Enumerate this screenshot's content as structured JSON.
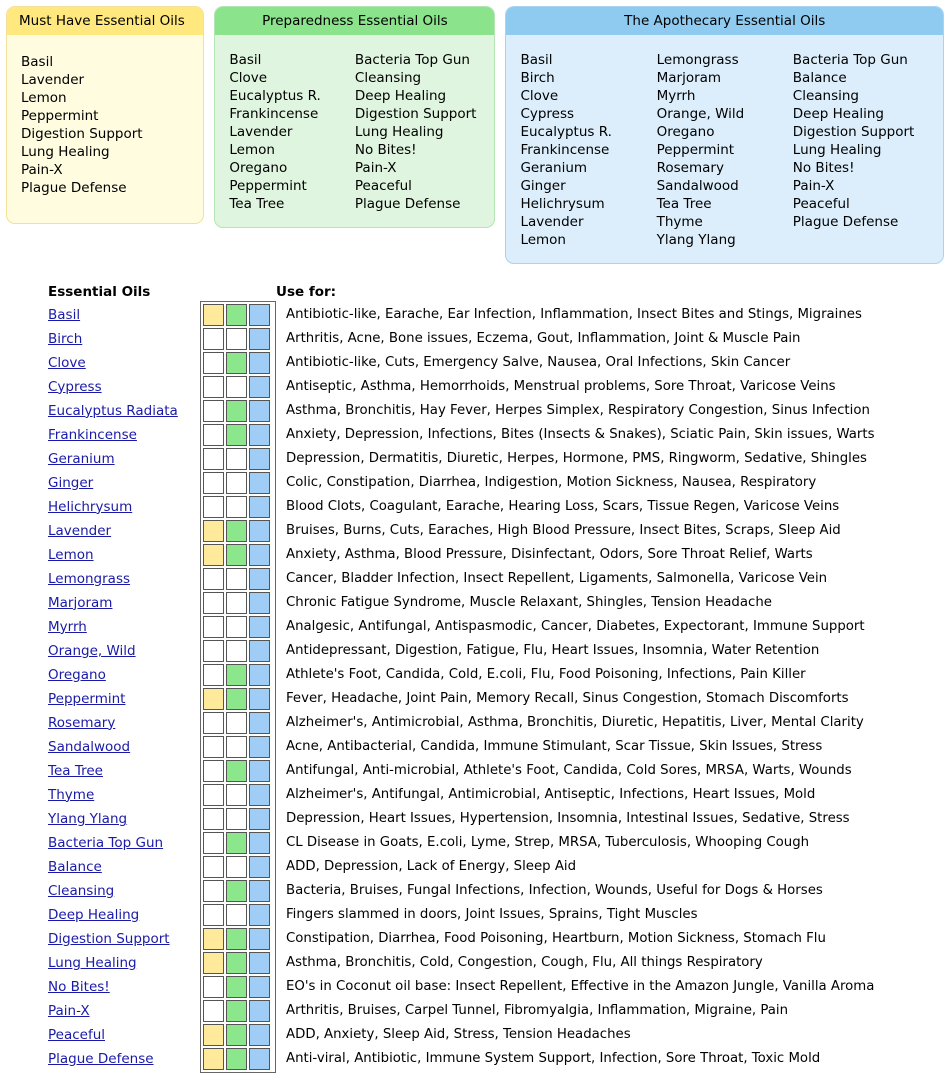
{
  "cards": [
    {
      "id": "must-have",
      "title": "Must Have Essential Oils",
      "header_color": "#ffe97f",
      "body_color": "#fffce0",
      "columns": [
        [
          "Basil",
          "Lavender",
          "Lemon",
          "Peppermint",
          "Digestion Support",
          "Lung Healing",
          "Pain-X",
          "Plague Defense"
        ]
      ]
    },
    {
      "id": "preparedness",
      "title": "Preparedness Essential Oils",
      "header_color": "#8be38b",
      "body_color": "#dff5df",
      "columns": [
        [
          "Basil",
          "Clove",
          "Eucalyptus R.",
          "Frankincense",
          "Lavender",
          "Lemon",
          "Oregano",
          "Peppermint",
          "Tea Tree"
        ],
        [
          "Bacteria Top Gun",
          "Cleansing",
          "Deep Healing",
          "Digestion Support",
          "Lung Healing",
          "No Bites!",
          "Pain-X",
          "Peaceful",
          "Plague Defense"
        ]
      ]
    },
    {
      "id": "apothecary",
      "title": "The Apothecary Essential Oils",
      "header_color": "#8fcbf0",
      "body_color": "#dceefb",
      "columns": [
        [
          "Basil",
          "Birch",
          "Clove",
          "Cypress",
          "Eucalyptus R.",
          "Frankincense",
          "Geranium",
          "Ginger",
          "Helichrysum",
          "Lavender",
          "Lemon"
        ],
        [
          "Lemongrass",
          "Marjoram",
          "Myrrh",
          "Orange, Wild",
          "Oregano",
          "Peppermint",
          "Rosemary",
          "Sandalwood",
          "Tea Tree",
          "Thyme",
          "Ylang Ylang"
        ],
        [
          "Bacteria Top Gun",
          "Balance",
          "Cleansing",
          "Deep Healing",
          "Digestion Support",
          "Lung Healing",
          "No Bites!",
          "Pain-X",
          "Peaceful",
          "Plague Defense"
        ]
      ]
    }
  ],
  "table": {
    "headers": {
      "oils": "Essential Oils",
      "use_for": "Use for:"
    },
    "swatch_colors": {
      "yellow": "#ffe99a",
      "green": "#8ce68c",
      "blue": "#9fcdf5",
      "empty": "#ffffff"
    },
    "link_color": "#1a1aa8",
    "rows": [
      {
        "name": "Basil",
        "swatches": [
          "yellow",
          "green",
          "blue"
        ],
        "use_for": "Antibiotic-like, Earache, Ear Infection, Inflammation, Insect Bites and Stings, Migraines"
      },
      {
        "name": "Birch",
        "swatches": [
          "none",
          "none",
          "blue"
        ],
        "use_for": "Arthritis, Acne, Bone issues, Eczema, Gout, Inflammation, Joint & Muscle Pain"
      },
      {
        "name": "Clove",
        "swatches": [
          "none",
          "green",
          "blue"
        ],
        "use_for": "Antibiotic-like, Cuts, Emergency Salve, Nausea, Oral Infections, Skin Cancer"
      },
      {
        "name": "Cypress",
        "swatches": [
          "none",
          "none",
          "blue"
        ],
        "use_for": "Antiseptic, Asthma, Hemorrhoids, Menstrual problems, Sore Throat, Varicose Veins"
      },
      {
        "name": "Eucalyptus Radiata",
        "swatches": [
          "none",
          "green",
          "blue"
        ],
        "use_for": "Asthma, Bronchitis, Hay Fever, Herpes Simplex, Respiratory Congestion, Sinus Infection"
      },
      {
        "name": "Frankincense",
        "swatches": [
          "none",
          "green",
          "blue"
        ],
        "use_for": "Anxiety, Depression, Infections, Bites (Insects & Snakes), Sciatic Pain, Skin issues, Warts"
      },
      {
        "name": "Geranium",
        "swatches": [
          "none",
          "none",
          "blue"
        ],
        "use_for": "Depression, Dermatitis, Diuretic, Herpes, Hormone, PMS, Ringworm, Sedative, Shingles"
      },
      {
        "name": "Ginger",
        "swatches": [
          "none",
          "none",
          "blue"
        ],
        "use_for": "Colic, Constipation, Diarrhea, Indigestion, Motion Sickness, Nausea, Respiratory"
      },
      {
        "name": "Helichrysum",
        "swatches": [
          "none",
          "none",
          "blue"
        ],
        "use_for": "Blood Clots, Coagulant, Earache, Hearing Loss, Scars, Tissue Regen, Varicose Veins"
      },
      {
        "name": "Lavender",
        "swatches": [
          "yellow",
          "green",
          "blue"
        ],
        "use_for": "Bruises, Burns, Cuts, Earaches, High Blood Pressure, Insect Bites, Scraps, Sleep Aid"
      },
      {
        "name": "Lemon",
        "swatches": [
          "yellow",
          "green",
          "blue"
        ],
        "use_for": "Anxiety, Asthma, Blood Pressure, Disinfectant, Odors, Sore Throat Relief, Warts"
      },
      {
        "name": "Lemongrass",
        "swatches": [
          "none",
          "none",
          "blue"
        ],
        "use_for": "Cancer, Bladder Infection, Insect Repellent, Ligaments, Salmonella, Varicose Vein"
      },
      {
        "name": "Marjoram",
        "swatches": [
          "none",
          "none",
          "blue"
        ],
        "use_for": "Chronic Fatigue Syndrome, Muscle Relaxant, Shingles, Tension Headache"
      },
      {
        "name": "Myrrh",
        "swatches": [
          "none",
          "none",
          "blue"
        ],
        "use_for": "Analgesic, Antifungal, Antispasmodic, Cancer, Diabetes, Expectorant, Immune Support"
      },
      {
        "name": "Orange, Wild",
        "swatches": [
          "none",
          "none",
          "blue"
        ],
        "use_for": "Antidepressant, Digestion, Fatigue, Flu, Heart Issues, Insomnia, Water Retention"
      },
      {
        "name": "Oregano",
        "swatches": [
          "none",
          "green",
          "blue"
        ],
        "use_for": "Athlete's Foot, Candida, Cold, E.coli, Flu, Food Poisoning, Infections, Pain Killer"
      },
      {
        "name": "Peppermint",
        "swatches": [
          "yellow",
          "green",
          "blue"
        ],
        "use_for": "Fever, Headache, Joint Pain, Memory Recall, Sinus Congestion, Stomach Discomforts"
      },
      {
        "name": "Rosemary",
        "swatches": [
          "none",
          "none",
          "blue"
        ],
        "use_for": "Alzheimer's, Antimicrobial, Asthma, Bronchitis, Diuretic, Hepatitis, Liver, Mental Clarity"
      },
      {
        "name": "Sandalwood",
        "swatches": [
          "none",
          "none",
          "blue"
        ],
        "use_for": "Acne, Antibacterial, Candida, Immune Stimulant, Scar Tissue, Skin Issues, Stress"
      },
      {
        "name": "Tea Tree",
        "swatches": [
          "none",
          "green",
          "blue"
        ],
        "use_for": "Antifungal, Anti-microbial, Athlete's Foot, Candida, Cold Sores, MRSA, Warts, Wounds"
      },
      {
        "name": "Thyme",
        "swatches": [
          "none",
          "none",
          "blue"
        ],
        "use_for": "Alzheimer's, Antifungal, Antimicrobial, Antiseptic, Infections, Heart Issues, Mold"
      },
      {
        "name": "Ylang Ylang",
        "swatches": [
          "none",
          "none",
          "blue"
        ],
        "use_for": "Depression, Heart Issues, Hypertension, Insomnia, Intestinal Issues, Sedative, Stress"
      },
      {
        "name": "Bacteria Top Gun",
        "swatches": [
          "none",
          "green",
          "blue"
        ],
        "use_for": "CL Disease in Goats, E.coli, Lyme, Strep, MRSA, Tuberculosis, Whooping Cough"
      },
      {
        "name": "Balance",
        "swatches": [
          "none",
          "none",
          "blue"
        ],
        "use_for": "ADD, Depression, Lack of Energy, Sleep Aid"
      },
      {
        "name": "Cleansing",
        "swatches": [
          "none",
          "green",
          "blue"
        ],
        "use_for": "Bacteria, Bruises, Fungal Infections, Infection, Wounds, Useful for Dogs & Horses"
      },
      {
        "name": "Deep Healing",
        "swatches": [
          "none",
          "none",
          "blue"
        ],
        "use_for": "Fingers slammed in doors, Joint Issues, Sprains, Tight Muscles"
      },
      {
        "name": "Digestion Support",
        "swatches": [
          "yellow",
          "green",
          "blue"
        ],
        "use_for": "Constipation, Diarrhea, Food Poisoning, Heartburn, Motion Sickness, Stomach Flu"
      },
      {
        "name": "Lung Healing",
        "swatches": [
          "yellow",
          "green",
          "blue"
        ],
        "use_for": "Asthma, Bronchitis, Cold, Congestion, Cough, Flu, All things Respiratory"
      },
      {
        "name": "No Bites!",
        "swatches": [
          "none",
          "green",
          "blue"
        ],
        "use_for": "EO's in Coconut oil base: Insect Repellent, Effective in the Amazon Jungle, Vanilla Aroma"
      },
      {
        "name": "Pain-X",
        "swatches": [
          "none",
          "green",
          "blue"
        ],
        "use_for": "Arthritis, Bruises, Carpel Tunnel, Fibromyalgia, Inflammation, Migraine, Pain"
      },
      {
        "name": "Peaceful",
        "swatches": [
          "yellow",
          "green",
          "blue"
        ],
        "use_for": "ADD, Anxiety, Sleep Aid, Stress, Tension Headaches"
      },
      {
        "name": "Plague Defense",
        "swatches": [
          "yellow",
          "green",
          "blue"
        ],
        "use_for": "Anti-viral, Antibiotic, Immune System Support, Infection, Sore Throat, Toxic Mold"
      }
    ]
  }
}
